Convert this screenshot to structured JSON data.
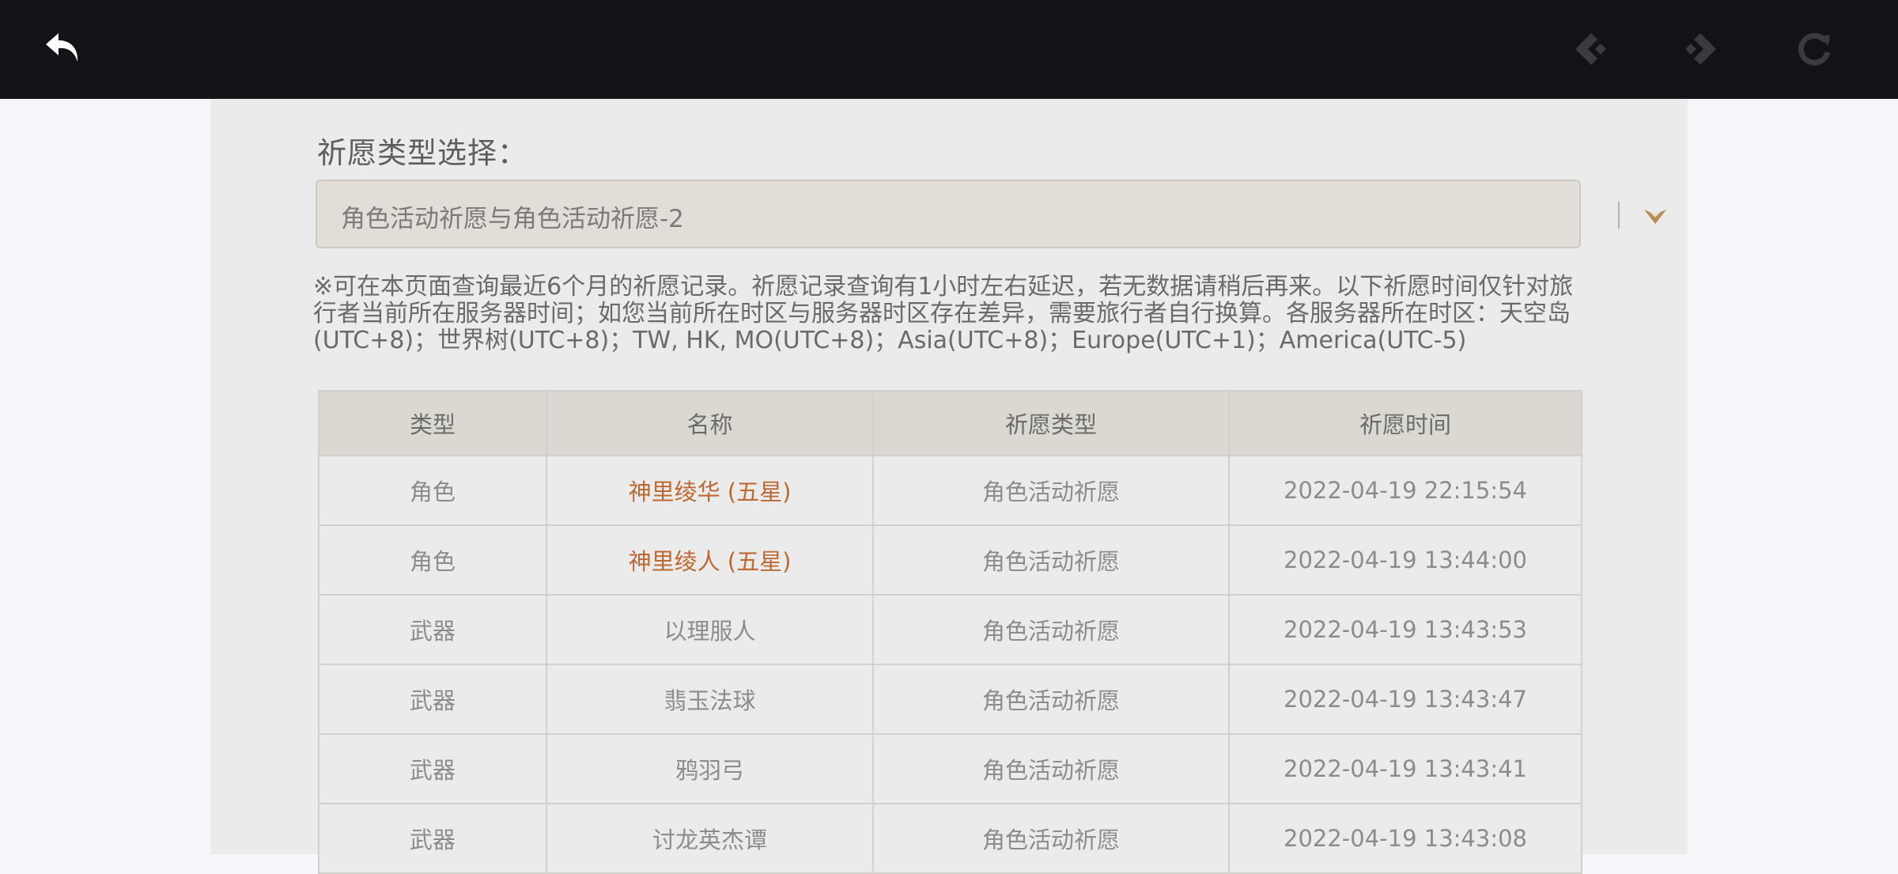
{
  "colors": {
    "topbar": "#121316",
    "panel": "#ebebeb",
    "five_star": "#bd6932",
    "dropdown_arrow": "#b98a52"
  },
  "toolbar": {
    "back_icon": "back-arrow-icon",
    "prev_icon": "prev-diamond-icon",
    "next_icon": "next-diamond-icon",
    "refresh_icon": "refresh-icon"
  },
  "wish": {
    "label": "祈愿类型选择：",
    "selected": "角色活动祈愿与角色活动祈愿-2",
    "dropdown_icon": "chevron-down-icon",
    "notice": "※可在本页面查询最近6个月的祈愿记录。祈愿记录查询有1小时左右延迟，若无数据请稍后再来。以下祈愿时间仅针对旅行者当前所在服务器时间；如您当前所在时区与服务器时区存在差异，需要旅行者自行换算。各服务器所在时区：天空岛(UTC+8)；世界树(UTC+8)；TW, HK, MO(UTC+8)；Asia(UTC+8)；Europe(UTC+1)；America(UTC-5)"
  },
  "table": {
    "headers": [
      "类型",
      "名称",
      "祈愿类型",
      "祈愿时间"
    ],
    "rows": [
      {
        "type": "角色",
        "name": "神里绫华 (五星)",
        "banner": "角色活动祈愿",
        "time": "2022-04-19 22:15:54",
        "five_star": true
      },
      {
        "type": "角色",
        "name": "神里绫人 (五星)",
        "banner": "角色活动祈愿",
        "time": "2022-04-19 13:44:00",
        "five_star": true
      },
      {
        "type": "武器",
        "name": "以理服人",
        "banner": "角色活动祈愿",
        "time": "2022-04-19 13:43:53",
        "five_star": false
      },
      {
        "type": "武器",
        "name": "翡玉法球",
        "banner": "角色活动祈愿",
        "time": "2022-04-19 13:43:47",
        "five_star": false
      },
      {
        "type": "武器",
        "name": "鸦羽弓",
        "banner": "角色活动祈愿",
        "time": "2022-04-19 13:43:41",
        "five_star": false
      },
      {
        "type": "武器",
        "name": "讨龙英杰谭",
        "banner": "角色活动祈愿",
        "time": "2022-04-19 13:43:08",
        "five_star": false
      }
    ]
  }
}
